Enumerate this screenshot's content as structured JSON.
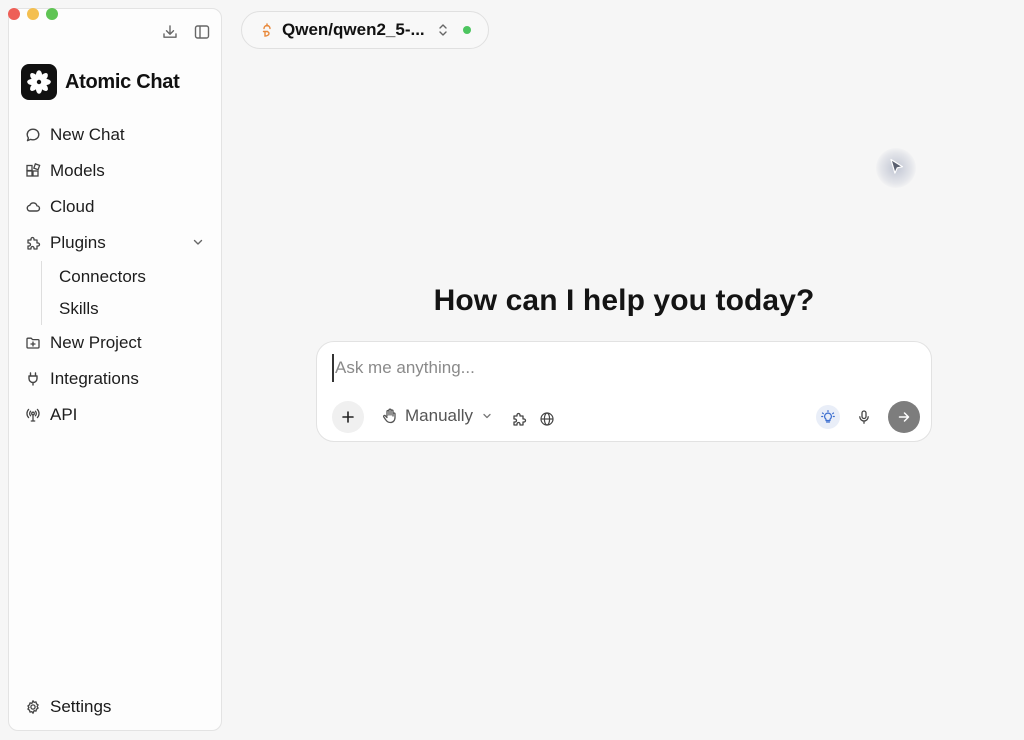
{
  "window": {
    "traffic_lights": [
      "close",
      "minimize",
      "maximize"
    ]
  },
  "sidebar": {
    "toolbar_icons": [
      "download-icon",
      "sidebar-toggle-icon"
    ],
    "brand": {
      "name": "Atomic Chat",
      "logo_icon": "atom-flower-icon"
    },
    "items": [
      {
        "label": "New Chat",
        "icon": "chat-bubble-icon"
      },
      {
        "label": "Models",
        "icon": "grid-blocks-icon"
      },
      {
        "label": "Cloud",
        "icon": "cloud-icon"
      },
      {
        "label": "Plugins",
        "icon": "puzzle-icon",
        "expanded": true,
        "children": [
          {
            "label": "Connectors"
          },
          {
            "label": "Skills"
          }
        ]
      },
      {
        "label": "New Project",
        "icon": "folder-plus-icon"
      },
      {
        "label": "Integrations",
        "icon": "plug-icon"
      },
      {
        "label": "API",
        "icon": "broadcast-icon"
      }
    ],
    "settings_label": "Settings"
  },
  "model_selector": {
    "label": "Qwen/qwen2_5-...",
    "status": "online",
    "status_color": "#4cc55f",
    "accent_color": "#e8883a"
  },
  "main": {
    "greeting": "How can I help you today?",
    "composer": {
      "placeholder": "Ask me anything...",
      "value": "",
      "mode_label": "Manually",
      "tools": [
        "add-icon",
        "hand-icon",
        "puzzle-icon",
        "globe-icon",
        "lightbulb-icon",
        "microphone-icon",
        "send-arrow-icon"
      ]
    }
  }
}
